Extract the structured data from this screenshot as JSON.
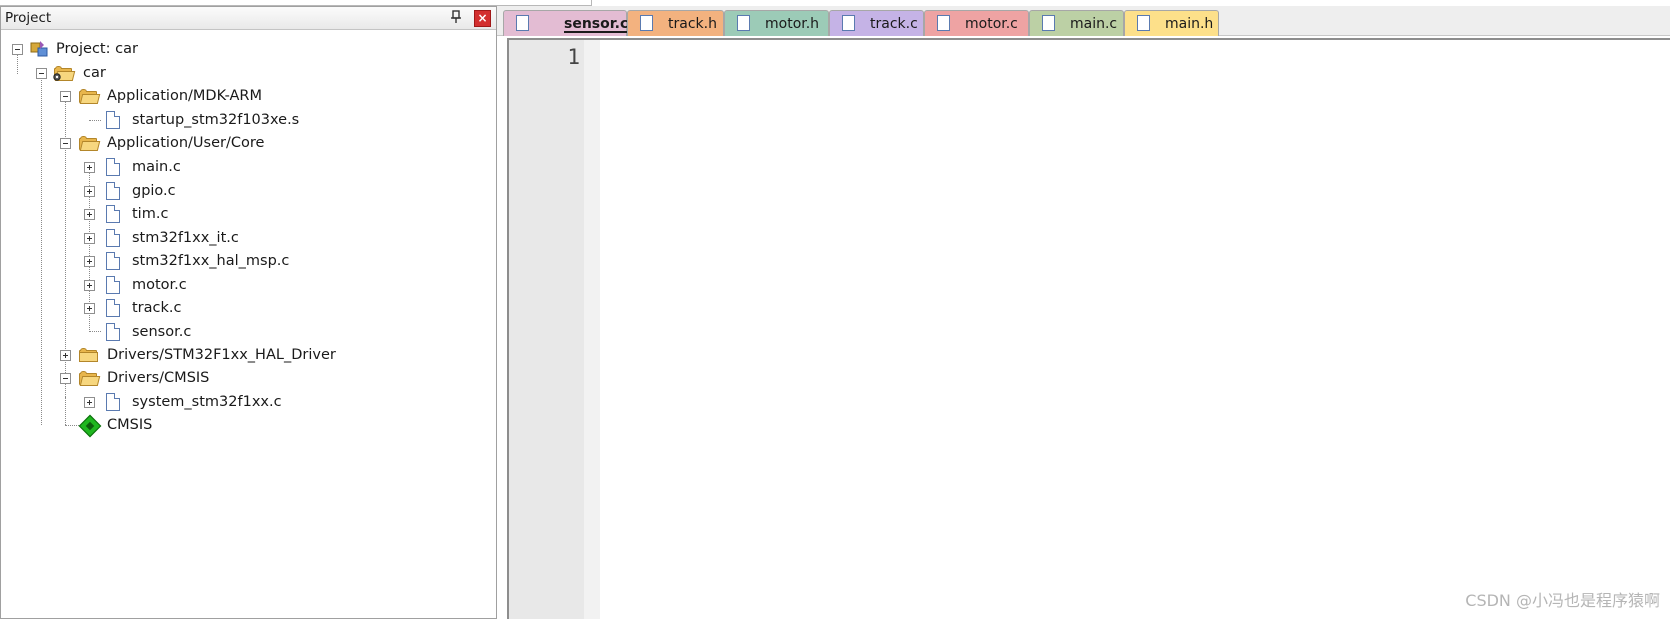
{
  "panel": {
    "title": "Project",
    "pin": "⌂",
    "close": "×"
  },
  "tree": {
    "root": "Project: car",
    "target": "car",
    "groups": {
      "app_mdk": "Application/MDK-ARM",
      "app_user": "Application/User/Core",
      "hal_driver": "Drivers/STM32F1xx_HAL_Driver",
      "cmsis_group": "Drivers/CMSIS",
      "cmsis_pack": "CMSIS"
    },
    "files": {
      "startup": "startup_stm32f103xe.s",
      "main_c": "main.c",
      "gpio_c": "gpio.c",
      "tim_c": "tim.c",
      "it_c": "stm32f1xx_it.c",
      "msp_c": "stm32f1xx_hal_msp.c",
      "motor_c": "motor.c",
      "track_c": "track.c",
      "sensor_c": "sensor.c",
      "system_c": "system_stm32f1xx.c"
    }
  },
  "editor": {
    "tabs": [
      {
        "label": "sensor.c",
        "color": "#e3bcd3",
        "active": true
      },
      {
        "label": "track.h",
        "color": "#f3b27f"
      },
      {
        "label": "motor.h",
        "color": "#9ccbb7"
      },
      {
        "label": "track.c",
        "color": "#c5b3e6"
      },
      {
        "label": "motor.c",
        "color": "#eea3a3"
      },
      {
        "label": "main.c",
        "color": "#bcd0a5"
      },
      {
        "label": "main.h",
        "color": "#fde08a"
      }
    ],
    "line_numbers": [
      "1"
    ]
  },
  "watermark": "CSDN @小冯也是程序猿啊"
}
